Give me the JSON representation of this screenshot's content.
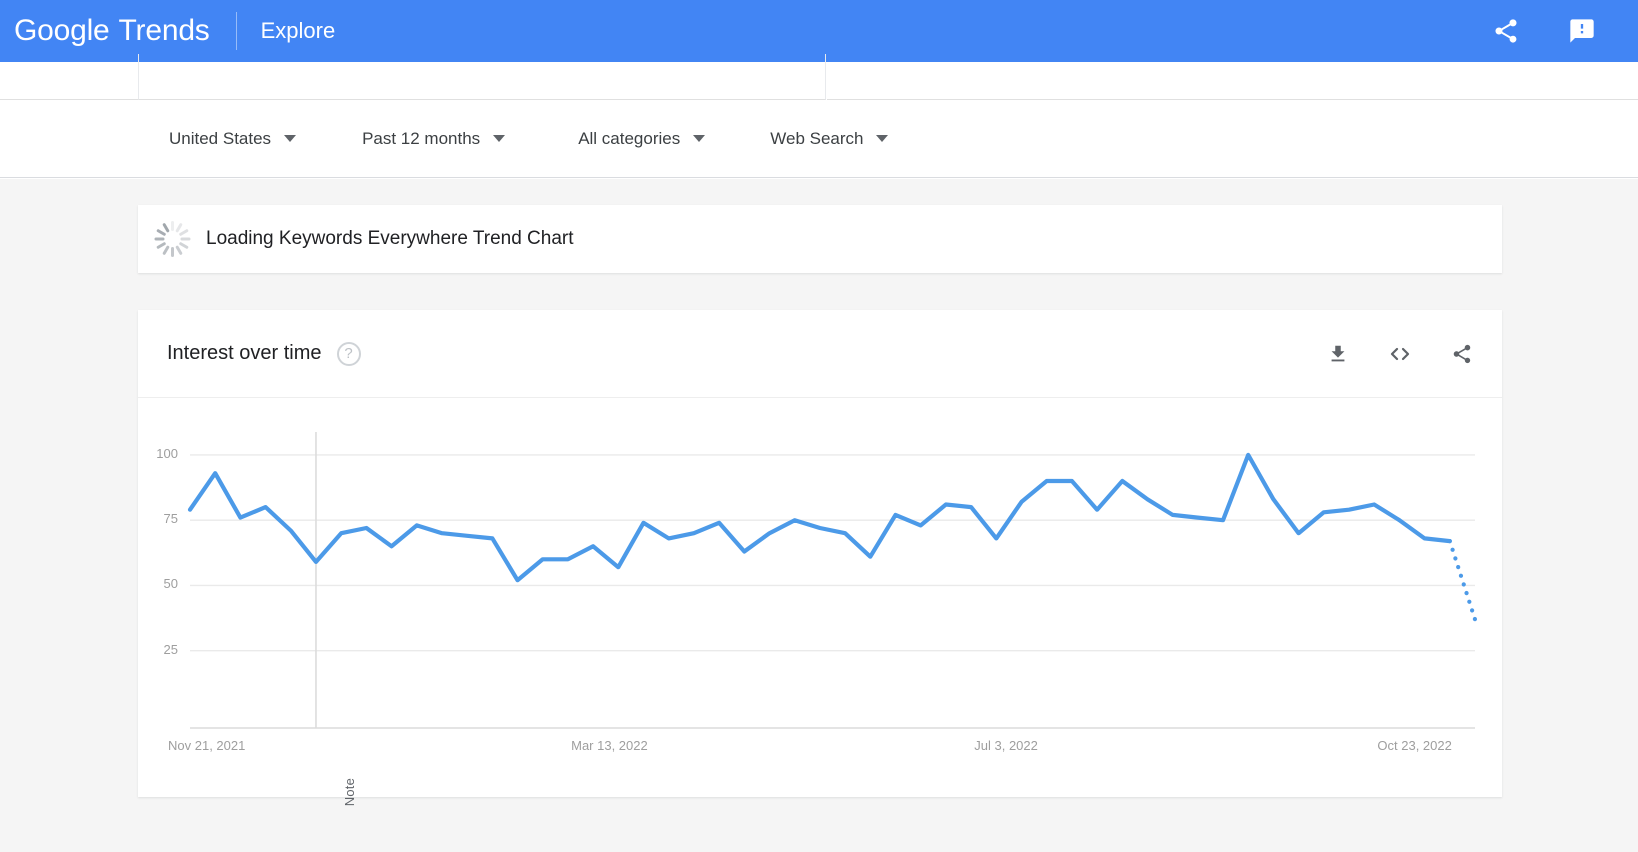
{
  "header": {
    "brand_google": "Google",
    "brand_trends": "Trends",
    "explore_label": "Explore",
    "share_icon": "share-icon",
    "feedback_icon": "feedback-icon",
    "background_color": "#4285f4"
  },
  "filters": [
    {
      "label": "United States",
      "icon": "chevron-down-icon"
    },
    {
      "label": "Past 12 months",
      "icon": "chevron-down-icon"
    },
    {
      "label": "All categories",
      "icon": "chevron-down-icon"
    },
    {
      "label": "Web Search",
      "icon": "chevron-down-icon"
    }
  ],
  "loading_card": {
    "text": "Loading Keywords Everywhere Trend Chart",
    "spinner_icon": "loading-spinner-icon"
  },
  "chart_card": {
    "title": "Interest over time",
    "help_icon": "help-circle-icon",
    "help_glyph": "?",
    "actions": [
      {
        "name": "download-csv-button",
        "icon": "download-icon"
      },
      {
        "name": "embed-button",
        "icon": "embed-code-icon"
      },
      {
        "name": "share-chart-button",
        "icon": "share-icon"
      }
    ]
  },
  "chart_data": {
    "type": "line",
    "title": "Interest over time",
    "xlabel": "",
    "ylabel": "",
    "ylim": [
      0,
      108
    ],
    "yticks": [
      25,
      50,
      75,
      100
    ],
    "ytick_labels": [
      "25",
      "50",
      "75",
      "100"
    ],
    "xtick_labels": [
      "Nov 21, 2021",
      "Mar 13, 2022",
      "Jul 3, 2022",
      "Oct 23, 2022"
    ],
    "xtick_positions": [
      0,
      16,
      32,
      48
    ],
    "grid": true,
    "legend": false,
    "line_color": "#4c9ae8",
    "annotation": {
      "label": "Note",
      "x_index": 5
    },
    "series": [
      {
        "name": "Interest",
        "values": [
          79,
          93,
          76,
          80,
          71,
          59,
          70,
          72,
          65,
          73,
          70,
          69,
          68,
          52,
          60,
          60,
          65,
          57,
          74,
          68,
          70,
          74,
          63,
          70,
          75,
          72,
          70,
          61,
          77,
          73,
          81,
          80,
          68,
          82,
          90,
          90,
          79,
          90,
          83,
          77,
          76,
          75,
          100,
          83,
          70,
          78,
          79,
          81,
          75,
          68,
          67
        ]
      }
    ],
    "partial_tail": {
      "dotted": true,
      "from_value": 67,
      "to_value": 37
    }
  }
}
